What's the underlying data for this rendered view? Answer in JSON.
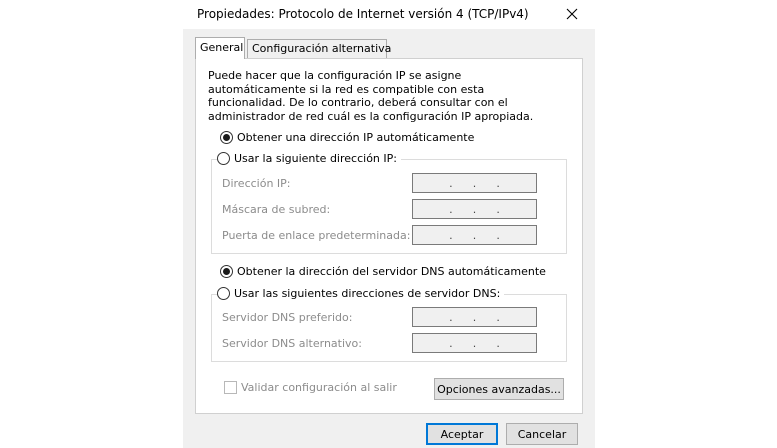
{
  "window": {
    "title": "Propiedades: Protocolo de Internet versión 4 (TCP/IPv4)",
    "close_icon": "close-icon"
  },
  "tabs": [
    {
      "label": "General",
      "selected": true
    },
    {
      "label": "Configuración alternativa",
      "selected": false
    }
  ],
  "general": {
    "description": "Puede hacer que la configuración IP se asigne automáticamente si la red es compatible con esta funcionalidad. De lo contrario, deberá consultar con el administrador de red cuál es la configuración IP apropiada.",
    "ip_auto_label": "Obtener una dirección IP automáticamente",
    "ip_auto_selected": true,
    "ip_manual_label": "Usar la siguiente dirección IP:",
    "ip_manual_selected": false,
    "ip_fields": [
      {
        "label": "Dirección IP:",
        "value": ". . ."
      },
      {
        "label": "Máscara de subred:",
        "value": ". . ."
      },
      {
        "label": "Puerta de enlace predeterminada:",
        "value": ". . ."
      }
    ],
    "dns_auto_label": "Obtener la dirección del servidor DNS automáticamente",
    "dns_auto_selected": true,
    "dns_manual_label": "Usar las siguientes direcciones de servidor DNS:",
    "dns_manual_selected": false,
    "dns_fields": [
      {
        "label": "Servidor DNS preferido:",
        "value": ". . ."
      },
      {
        "label": "Servidor DNS alternativo:",
        "value": ". . ."
      }
    ],
    "validate_label": "Validar configuración al salir",
    "validate_checked": false,
    "advanced_button": "Opciones avanzadas..."
  },
  "footer": {
    "ok_button": "Aceptar",
    "cancel_button": "Cancelar"
  }
}
